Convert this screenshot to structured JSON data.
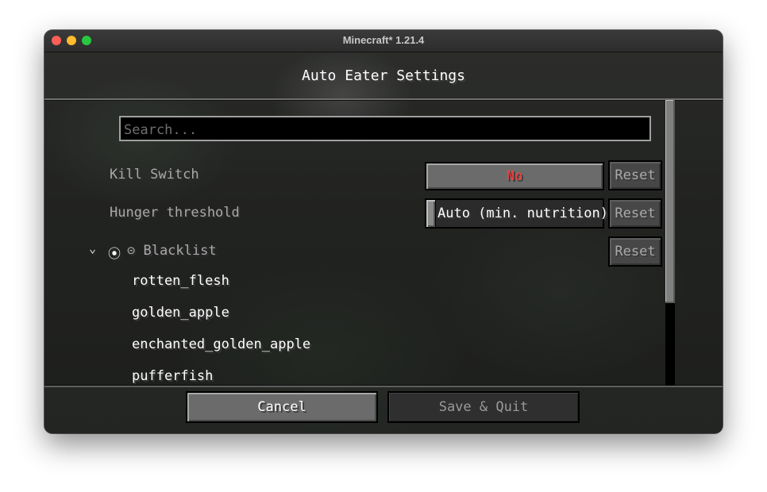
{
  "window": {
    "title": "Minecraft* 1.21.4"
  },
  "screen": {
    "title": "Auto Eater Settings"
  },
  "search": {
    "placeholder": "Search..."
  },
  "options": {
    "kill_switch": {
      "label": "Kill Switch",
      "value": "No",
      "value_color": "#ff3b3b",
      "reset_label": "Reset"
    },
    "hunger_threshold": {
      "label": "Hunger threshold",
      "value": "Auto (min. nutrition)",
      "slider_level": 0,
      "reset_label": "Reset"
    },
    "blacklist": {
      "label": "⊝ Blacklist",
      "expanded": true,
      "chevron": "⌄",
      "add_icon": "⦿",
      "reset_label": "Reset",
      "items": [
        "rotten_flesh",
        "golden_apple",
        "enchanted_golden_apple",
        "pufferfish"
      ]
    }
  },
  "footer": {
    "cancel_label": "Cancel",
    "save_label": "Save & Quit"
  },
  "colors": {
    "close": "#ff5f57",
    "minimize": "#febc2e",
    "maximize": "#28c840"
  }
}
